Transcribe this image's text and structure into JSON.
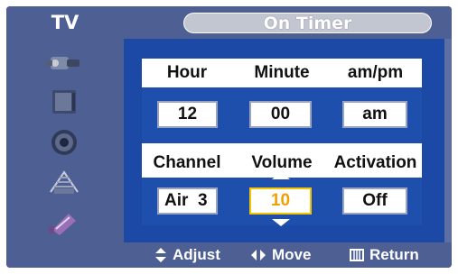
{
  "header": {
    "section_label": "TV",
    "title": "On Timer"
  },
  "sidebar": {
    "icons": [
      "input-plug-icon",
      "picture-screen-icon",
      "sound-speaker-icon",
      "channel-antenna-icon",
      "setup-connector-icon"
    ]
  },
  "timer": {
    "headers_row1": [
      "Hour",
      "Minute",
      "am/pm"
    ],
    "values_row1": [
      "12",
      "00",
      "am"
    ],
    "headers_row2": [
      "Channel",
      "Volume",
      "Activation"
    ],
    "channel": "Air  3",
    "volume": "10",
    "activation": "Off"
  },
  "footer": {
    "adjust": "Adjust",
    "move": "Move",
    "return": "Return"
  },
  "colors": {
    "panel": "#1d49a6",
    "frame": "#4e5f93",
    "selected_border": "#f2c500",
    "selected_text": "#f2a000"
  }
}
